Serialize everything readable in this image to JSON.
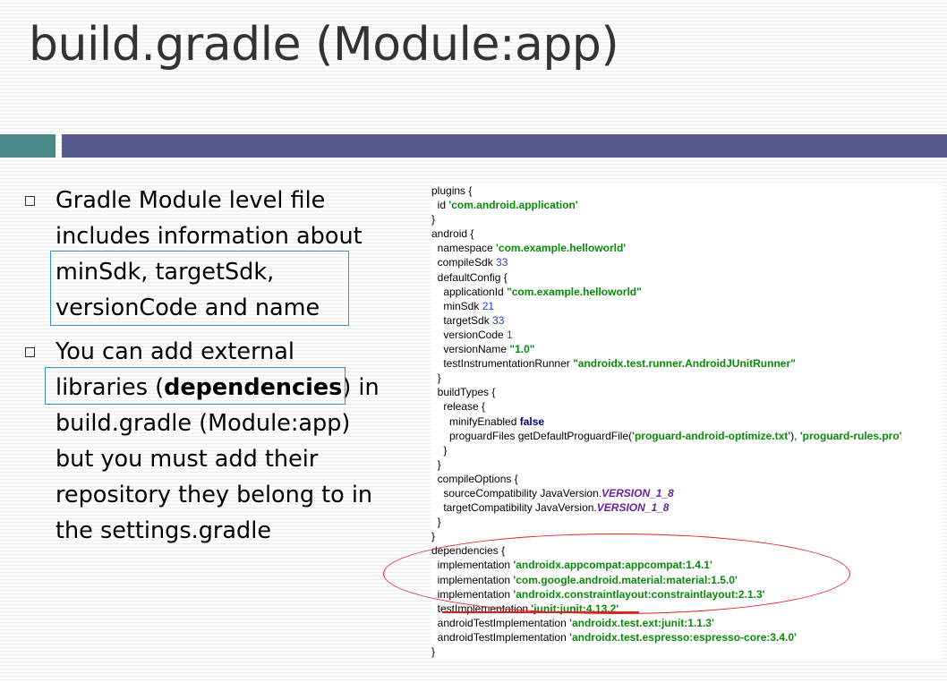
{
  "slide": {
    "title": "build.gradle (Module:app)",
    "bullets": [
      {
        "lines": [
          "Gradle Module level file",
          "includes information about",
          "minSdk, targetSdk,",
          "versionCode and name"
        ]
      },
      {
        "line1": "You can add external",
        "line2_pre": "libraries (",
        "line2_bold": "dependencies",
        "line2_post": ") in",
        "lines_rest": [
          "build.gradle (Module:app)",
          "but you must add their",
          "repository they belong to in",
          "the settings.gradle"
        ]
      }
    ]
  },
  "code": {
    "lines": [
      [
        {
          "t": "plugins {"
        }
      ],
      [
        {
          "t": "  id "
        },
        {
          "t": "'com.android.application'",
          "c": "s"
        }
      ],
      [
        {
          "t": "}"
        }
      ],
      [
        {
          "t": "android {"
        }
      ],
      [
        {
          "t": "  namespace "
        },
        {
          "t": "'com.example.helloworld'",
          "c": "s"
        }
      ],
      [
        {
          "t": "  compileSdk "
        },
        {
          "t": "33",
          "c": "n"
        }
      ],
      [
        {
          "t": "  defaultConfig {"
        }
      ],
      [
        {
          "t": "    applicationId "
        },
        {
          "t": "\"com.example.helloworld\"",
          "c": "s"
        }
      ],
      [
        {
          "t": "    minSdk "
        },
        {
          "t": "21",
          "c": "n"
        }
      ],
      [
        {
          "t": "    targetSdk "
        },
        {
          "t": "33",
          "c": "n"
        }
      ],
      [
        {
          "t": "    versionCode "
        },
        {
          "t": "1",
          "c": "n"
        }
      ],
      [
        {
          "t": "    versionName "
        },
        {
          "t": "\"1.0\"",
          "c": "s"
        }
      ],
      [
        {
          "t": "    testInstrumentationRunner "
        },
        {
          "t": "\"androidx.test.runner.AndroidJUnitRunner\"",
          "c": "s"
        }
      ],
      [
        {
          "t": "  }"
        }
      ],
      [
        {
          "t": "  buildTypes {"
        }
      ],
      [
        {
          "t": "    release {"
        }
      ],
      [
        {
          "t": "      minifyEnabled "
        },
        {
          "t": "false",
          "c": "k"
        }
      ],
      [
        {
          "t": "      proguardFiles getDefaultProguardFile("
        },
        {
          "t": "'proguard-android-optimize.txt'",
          "c": "s"
        },
        {
          "t": "), "
        },
        {
          "t": "'proguard-rules.pro'",
          "c": "s"
        }
      ],
      [
        {
          "t": "    }"
        }
      ],
      [
        {
          "t": "  }"
        }
      ],
      [
        {
          "t": "  compileOptions {"
        }
      ],
      [
        {
          "t": "    sourceCompatibility JavaVersion."
        },
        {
          "t": "VERSION_1_8",
          "c": "c"
        }
      ],
      [
        {
          "t": "    targetCompatibility JavaVersion."
        },
        {
          "t": "VERSION_1_8",
          "c": "c"
        }
      ],
      [
        {
          "t": "  }"
        }
      ],
      [
        {
          "t": "}"
        }
      ],
      [
        {
          "t": "dependencies {"
        }
      ],
      [
        {
          "t": "  implementation "
        },
        {
          "t": "'androidx.appcompat:appcompat:1.4.1'",
          "c": "s"
        }
      ],
      [
        {
          "t": "  implementation "
        },
        {
          "t": "'com.google.android.material:material:1.5.0'",
          "c": "s"
        }
      ],
      [
        {
          "t": "  implementation "
        },
        {
          "t": "'androidx.constraintlayout:constraintlayout:2.1.3'",
          "c": "s"
        }
      ],
      [
        {
          "t": "  testImplementation "
        },
        {
          "t": "'junit:junit:4.13.2'",
          "c": "s"
        }
      ],
      [
        {
          "t": "  androidTestImplementation "
        },
        {
          "t": "'androidx.test.ext:junit:1.1.3'",
          "c": "s"
        }
      ],
      [
        {
          "t": "  androidTestImplementation "
        },
        {
          "t": "'androidx.test.espresso:espresso-core:3.4.0'",
          "c": "s"
        }
      ],
      [
        {
          "t": "}"
        }
      ]
    ]
  },
  "colors": {
    "accent_teal": "#4a8a8a",
    "accent_blue": "#565a8e",
    "highlight_box": "#2e97c9",
    "annotation_red": "#e02020",
    "code_string": "#0a8a0a",
    "code_number": "#1f3fd0",
    "code_keyword": "#000080",
    "code_constant": "#6a1fa0"
  }
}
